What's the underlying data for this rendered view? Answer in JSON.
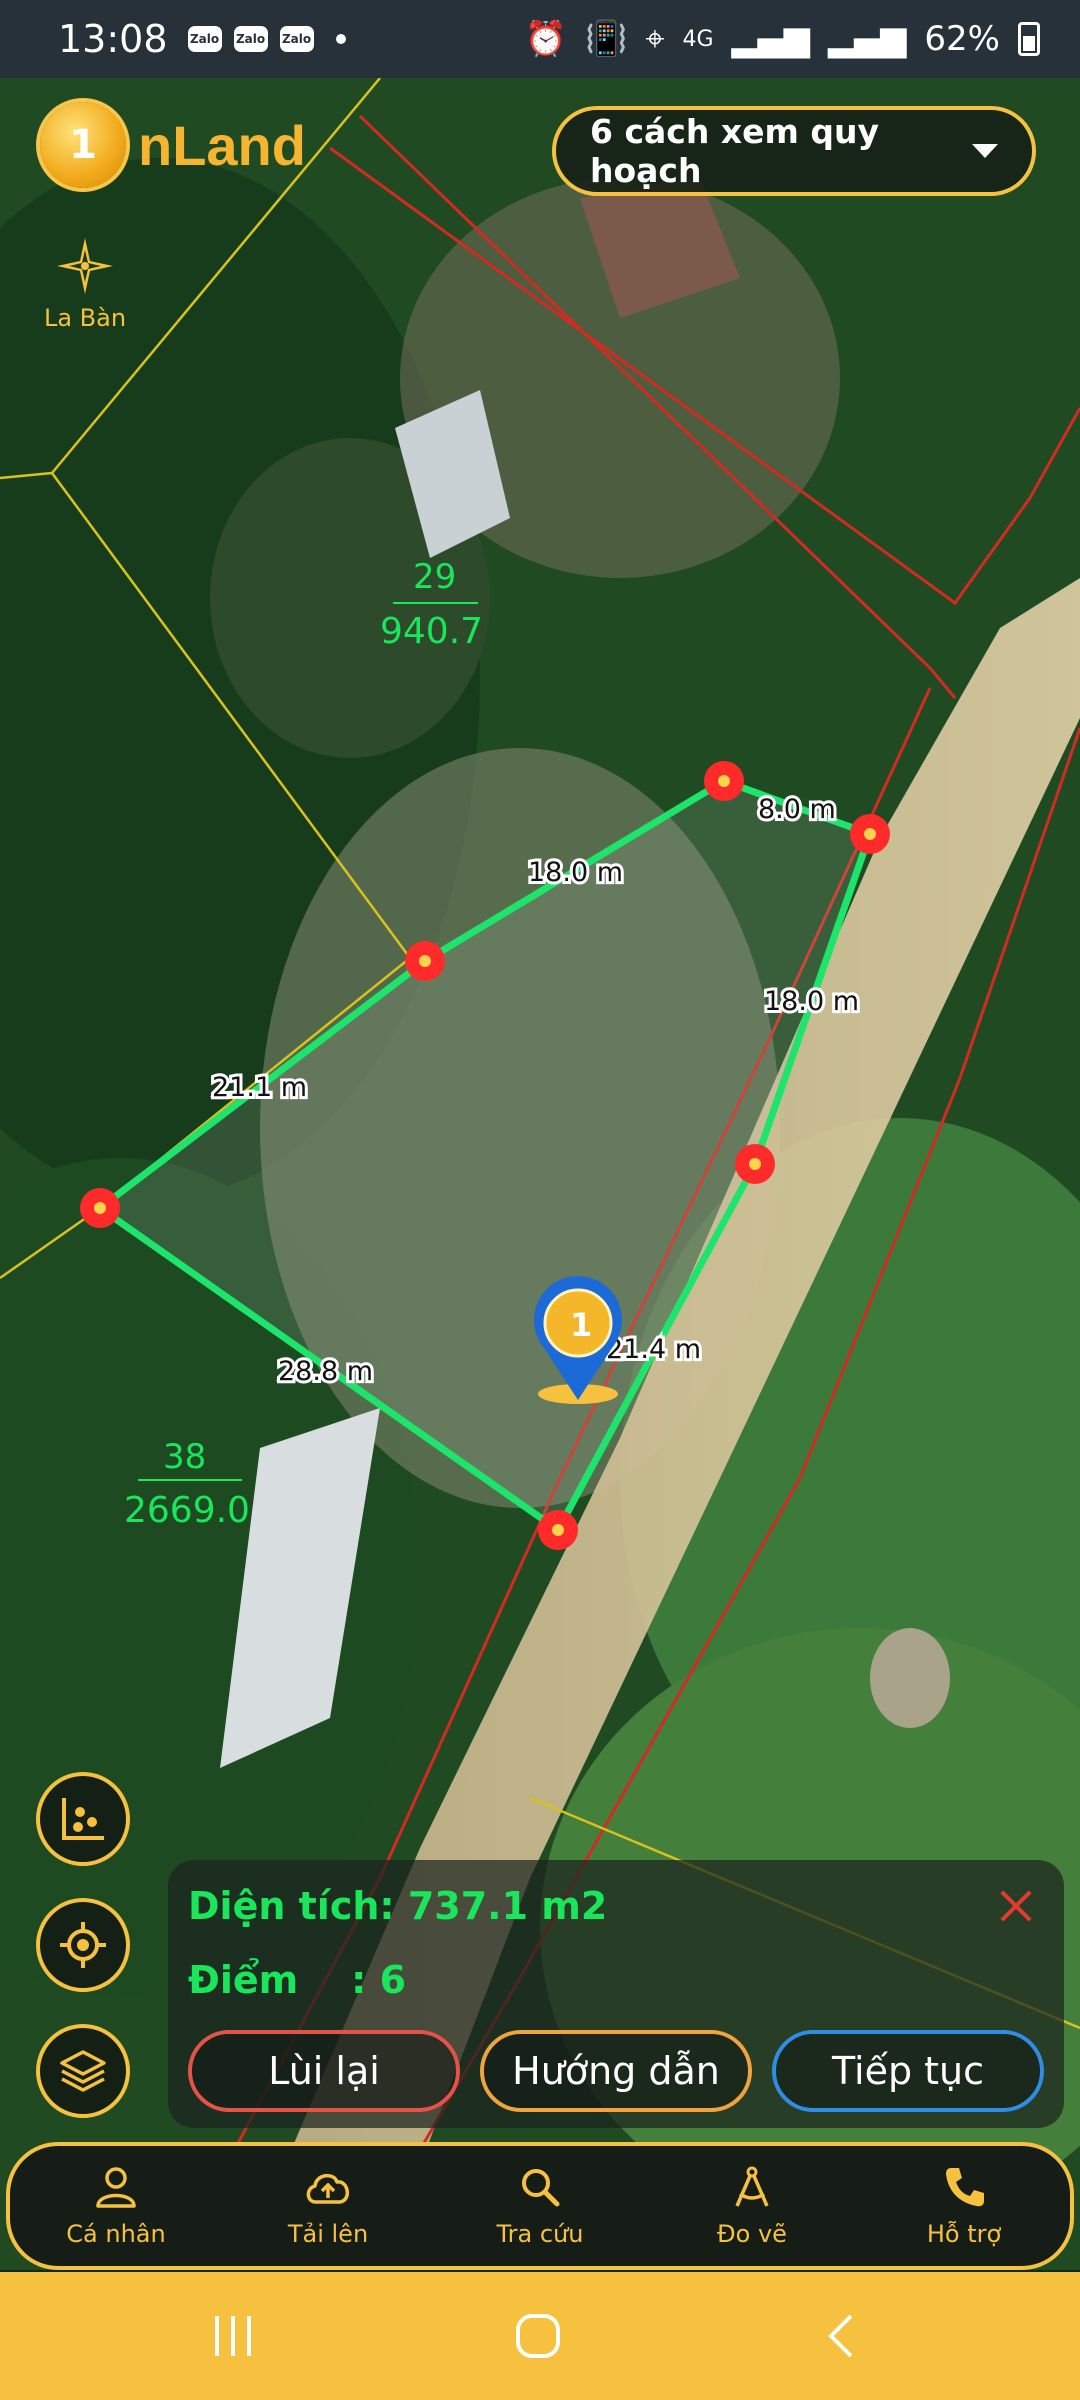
{
  "status_bar": {
    "time": "13:08",
    "notifications": [
      "Zalo",
      "Zalo",
      "Zalo"
    ],
    "network": "4G",
    "battery": "62%"
  },
  "app": {
    "logo_text": "nLand",
    "logo_mark": "1"
  },
  "header": {
    "dropdown_label": "6 cách xem quy hoạch"
  },
  "compass": {
    "label": "La Bàn"
  },
  "map": {
    "parcel_labels": [
      {
        "number": "29",
        "area": "940.7"
      },
      {
        "number": "38",
        "area": "2669.0"
      }
    ],
    "segment_labels": [
      "8.0 m",
      "18.0 m",
      "18.0 m",
      "21.1 m",
      "28.8 m",
      "21.4 m"
    ],
    "colors": {
      "measure_line": "#1de46b",
      "boundary_red": "#d32a22",
      "boundary_yellow": "#d8c21d",
      "vertex": "#ff2b2b"
    }
  },
  "left_controls": [
    {
      "name": "scatter-chart-icon"
    },
    {
      "name": "locate-icon"
    },
    {
      "name": "layers-icon"
    }
  ],
  "measure_panel": {
    "area_text": "Diện tích: 737.1 m2",
    "points_text": "Điểm    : 6",
    "back_label": "Lùi lại",
    "guide_label": "Hướng dẫn",
    "next_label": "Tiếp tục"
  },
  "bottom_nav": [
    {
      "label": "Cá nhân",
      "icon": "person-icon"
    },
    {
      "label": "Tải lên",
      "icon": "cloud-upload-icon"
    },
    {
      "label": "Tra cứu",
      "icon": "search-icon"
    },
    {
      "label": "Đo vẽ",
      "icon": "compass-draw-icon"
    },
    {
      "label": "Hỗ trợ",
      "icon": "phone-icon"
    }
  ],
  "theme": {
    "accent": "#f6c13e",
    "success": "#19e65b"
  }
}
